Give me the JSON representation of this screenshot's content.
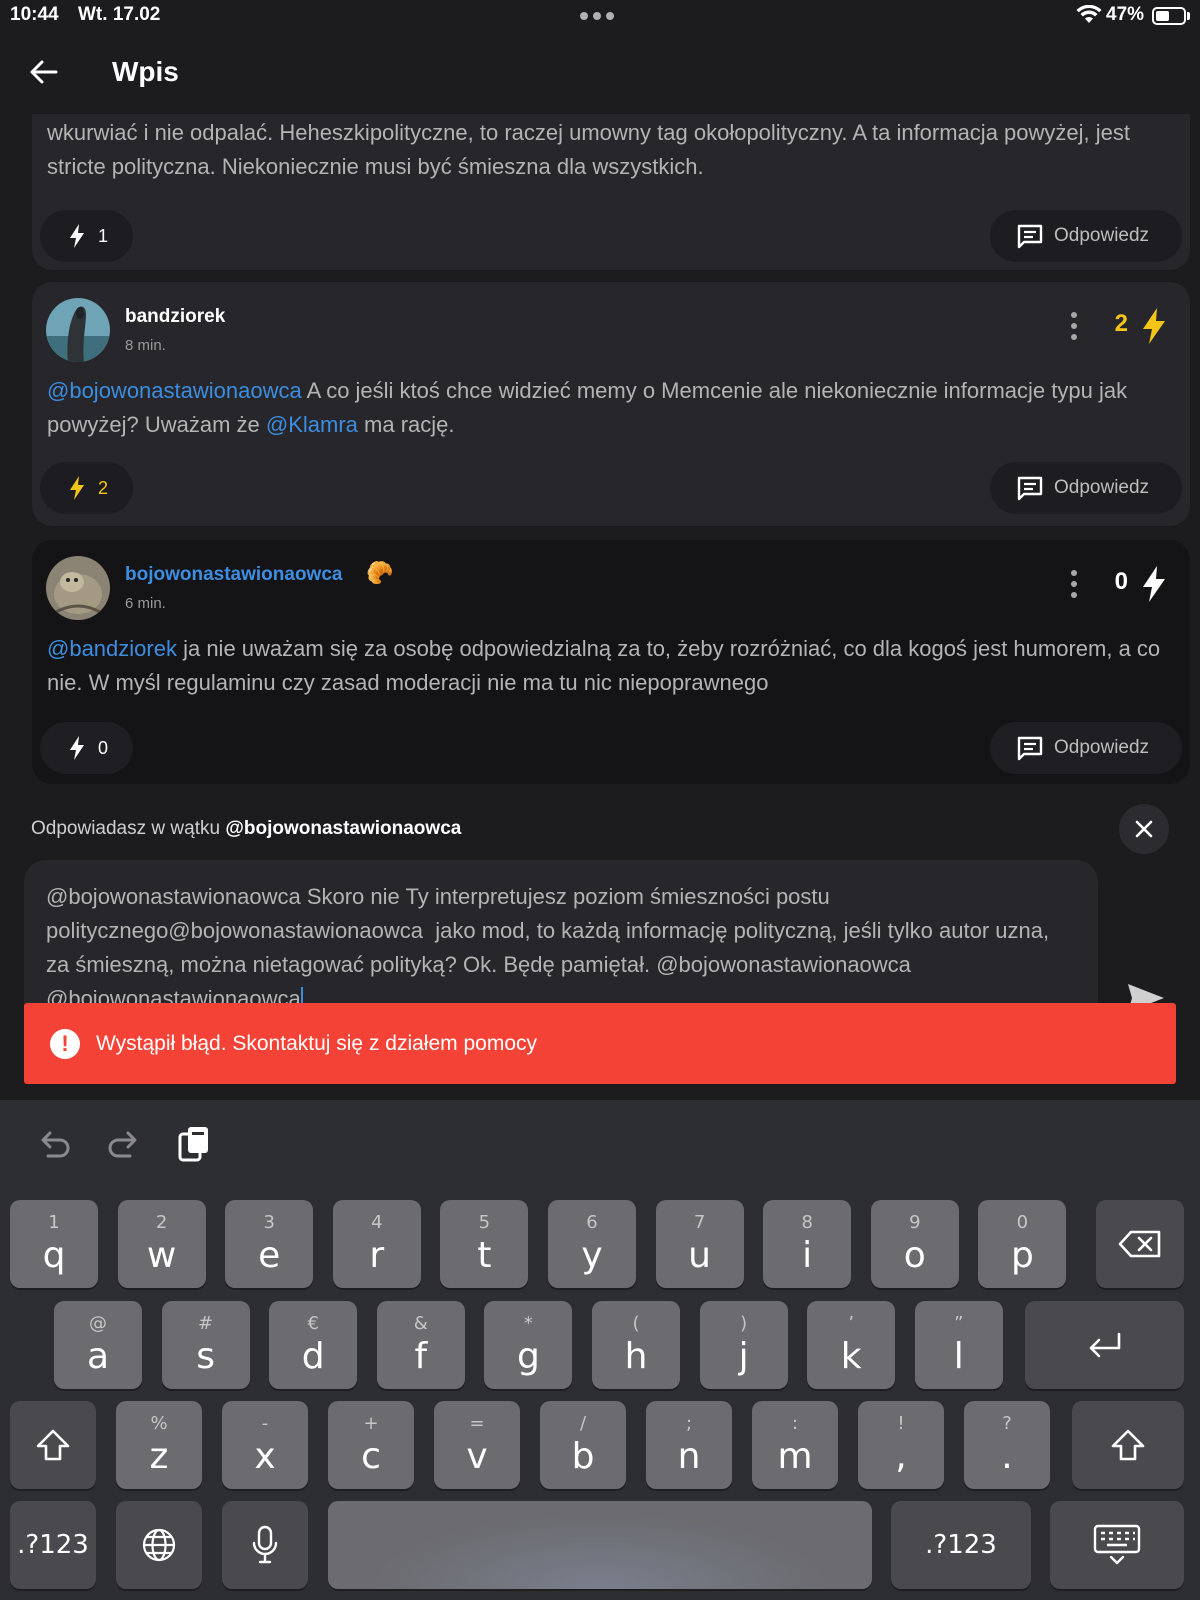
{
  "status": {
    "time": "10:44",
    "date": "Wt. 17.02",
    "battery": "47%"
  },
  "header": {
    "title": "Wpis"
  },
  "posts": [
    {
      "text": "wkurwiać i nie odpalać. Heheszkipolityczne, to raczej umowny tag okołopolityczny. A ta informacja powyżej, jest stricte polityczna. Niekoniecznie musi być śmieszna dla wszystkich.",
      "votes": "1",
      "reply_label": "Odpowiedz"
    },
    {
      "author": "bandziorek",
      "time": "8 min.",
      "score": "2",
      "score_color": "#f5c518",
      "text_mention_1": "@bojowonastawionaowca",
      "text_part_1": " A co jeśli ktoś chce widzieć memy o Memcenie ale niekoniecznie informacje typu jak powyżej? Uważam że ",
      "text_mention_2": "@Klamra",
      "text_part_2": " ma rację.",
      "votes": "2",
      "reply_label": "Odpowiedz"
    },
    {
      "author": "bojowonastawionaowca",
      "author_badge": "🥐",
      "time": "6 min.",
      "score": "0",
      "score_color": "#ffffff",
      "text_mention_1": "@bandziorek",
      "text_part_1": " ja nie uważam się za osobę odpowiedzialną za to, żeby rozróżniać, co dla kogoś jest humorem, a co nie. W myśl regulaminu czy zasad moderacji nie ma tu nic niepoprawnego",
      "votes": "0",
      "reply_label": "Odpowiedz"
    }
  ],
  "reply_context": {
    "prefix": "Odpowiadasz w wątku ",
    "user": "@bojowonastawionaowca"
  },
  "composer": {
    "value": "@bojowonastawionaowca Skoro nie Ty interpretujesz poziom śmieszności postu politycznego@bojowonastawionaowca  jako mod, to każdą informację polityczną, jeśli tylko autor uzna, za śmieszną, można nietagować polityką? Ok. Będę pamiętał. @bojowonastawionaowca @bojowonastawionaowca"
  },
  "error": {
    "message": "Wystąpił błąd. Skontaktuj się z działem pomocy"
  },
  "keyboard": {
    "row1": [
      {
        "main": "q",
        "sub": "1"
      },
      {
        "main": "w",
        "sub": "2"
      },
      {
        "main": "e",
        "sub": "3"
      },
      {
        "main": "r",
        "sub": "4"
      },
      {
        "main": "t",
        "sub": "5"
      },
      {
        "main": "y",
        "sub": "6"
      },
      {
        "main": "u",
        "sub": "7"
      },
      {
        "main": "i",
        "sub": "8"
      },
      {
        "main": "o",
        "sub": "9"
      },
      {
        "main": "p",
        "sub": "0"
      }
    ],
    "row2": [
      {
        "main": "a",
        "sub": "@"
      },
      {
        "main": "s",
        "sub": "#"
      },
      {
        "main": "d",
        "sub": "€"
      },
      {
        "main": "f",
        "sub": "&"
      },
      {
        "main": "g",
        "sub": "*"
      },
      {
        "main": "h",
        "sub": "("
      },
      {
        "main": "j",
        "sub": ")"
      },
      {
        "main": "k",
        "sub": "’"
      },
      {
        "main": "l",
        "sub": "”"
      }
    ],
    "row3": [
      {
        "main": "z",
        "sub": "%"
      },
      {
        "main": "x",
        "sub": "-"
      },
      {
        "main": "c",
        "sub": "+"
      },
      {
        "main": "v",
        "sub": "="
      },
      {
        "main": "b",
        "sub": "/"
      },
      {
        "main": "n",
        "sub": ";"
      },
      {
        "main": "m",
        "sub": ":"
      },
      {
        "main": ",",
        "sub": "!"
      },
      {
        "main": ".",
        "sub": "?"
      }
    ],
    "numbers_label": ".?123"
  }
}
